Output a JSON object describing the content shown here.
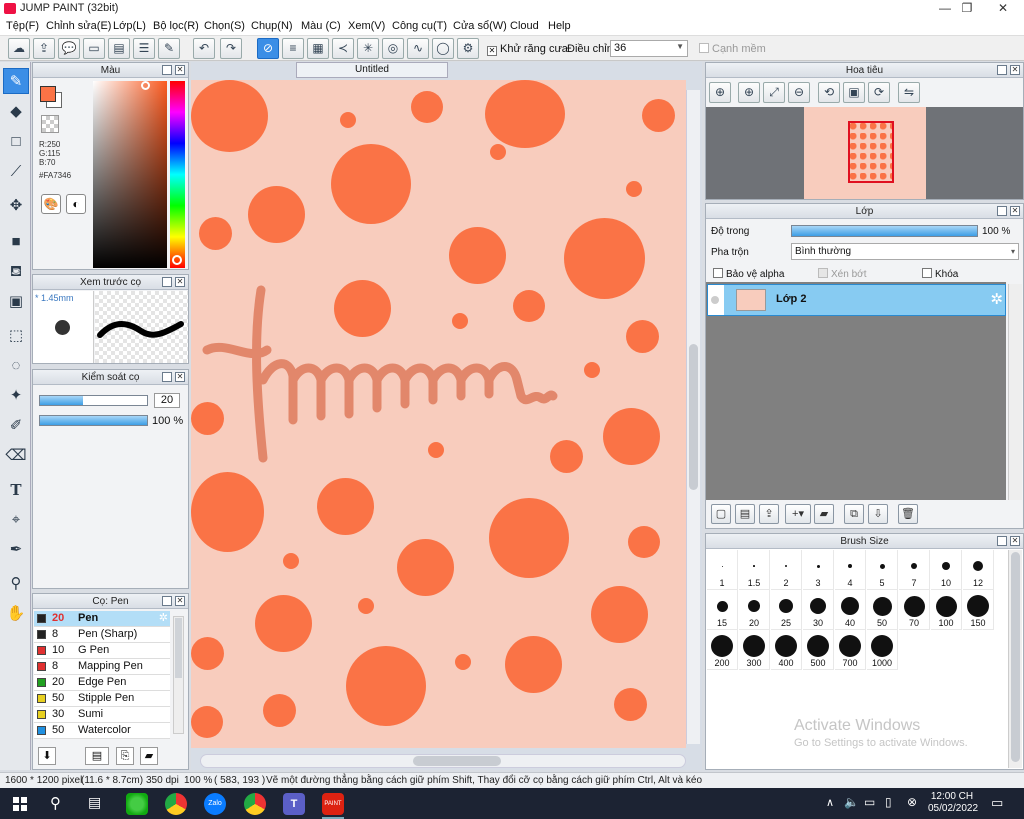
{
  "window": {
    "title": "JUMP PAINT (32bit)",
    "min": "—",
    "restore": "❐",
    "close": "✕"
  },
  "menu": [
    "Tệp(F)",
    "Chỉnh sửa(E)",
    "Lớp(L)",
    "Bộ lọc(R)",
    "Chọn(S)",
    "Chụp(N)",
    "Màu (C)",
    "Xem(V)",
    "Công cụ(T)",
    "Cửa sổ(W)",
    "Cloud",
    "Help"
  ],
  "toolbar": {
    "antialias_label": "Khử răng cưa",
    "adjust_label": "Điều chỉnh",
    "adjust_value": "36",
    "smooth_label": "Cạnh mềm"
  },
  "color_panel": {
    "title": "Màu",
    "r": "R:250",
    "g": "G:115",
    "b": "B:70",
    "hex": "#FA7346",
    "fg_color": "#fa7346"
  },
  "preview_panel": {
    "title": "Xem trước cọ",
    "size": "* 1.45mm"
  },
  "control_panel": {
    "title": "Kiểm soát cọ",
    "size_value": "20",
    "opacity_value": "100 %",
    "size_fraction": 0.4,
    "opacity_fraction": 1.0
  },
  "brush_panel": {
    "title": "Cọ: Pen",
    "items": [
      {
        "size": "20",
        "name": "Pen",
        "color": "#222222"
      },
      {
        "size": "8",
        "name": "Pen (Sharp)",
        "color": "#222222"
      },
      {
        "size": "10",
        "name": "G Pen",
        "color": "#e03030"
      },
      {
        "size": "8",
        "name": "Mapping Pen",
        "color": "#e03030"
      },
      {
        "size": "20",
        "name": "Edge Pen",
        "color": "#20a020"
      },
      {
        "size": "50",
        "name": "Stipple Pen",
        "color": "#e8d020"
      },
      {
        "size": "30",
        "name": "Sumi",
        "color": "#e8d020"
      },
      {
        "size": "50",
        "name": "Watercolor",
        "color": "#2090e0"
      }
    ]
  },
  "canvas": {
    "tab_title": "Untitled",
    "lettering": "hmmmm"
  },
  "navigator": {
    "title": "Hoa tiêu"
  },
  "layer_panel": {
    "title": "Lớp",
    "opacity_label": "Độ trong",
    "opacity_value": "100 %",
    "blend_label": "Pha trộn",
    "blend_value": "Bình thường",
    "protect_alpha": "Bảo vệ alpha",
    "clipping": "Xén bớt",
    "lock": "Khóa",
    "layer_name": "Lớp 2"
  },
  "brush_size_panel": {
    "title": "Brush Size",
    "sizes": [
      "1",
      "1.5",
      "2",
      "3",
      "4",
      "5",
      "7",
      "10",
      "12",
      "15",
      "20",
      "25",
      "30",
      "40",
      "50",
      "70",
      "100",
      "150",
      "200",
      "300",
      "400",
      "500",
      "700",
      "1000"
    ]
  },
  "watermark": {
    "line1": "Activate Windows",
    "line2": "Go to Settings to activate Windows."
  },
  "status": {
    "dimensions": "1600 * 1200 pixel",
    "physical": "(11.6 * 8.7cm)",
    "dpi": "350 dpi",
    "zoom": "100 %",
    "coords": "( 583, 193 )",
    "hint": "Vẽ một đường thẳng bằng cách giữ phím Shift, Thay đổi cỡ cọ bằng cách giữ phím Ctrl, Alt và kéo"
  },
  "taskbar": {
    "time": "12:00 CH",
    "date": "05/02/2022"
  }
}
